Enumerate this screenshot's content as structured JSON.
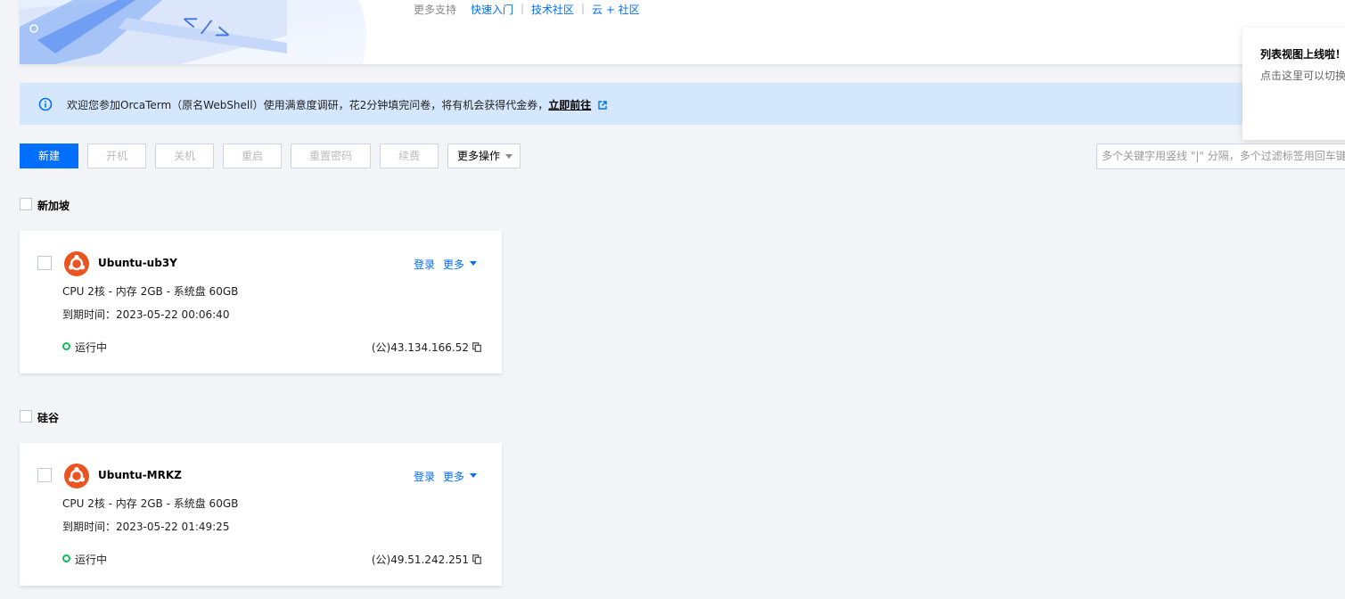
{
  "header": {
    "support_label": "更多支持",
    "links": [
      "快速入门",
      "技术社区",
      "云 + 社区"
    ],
    "separators": [
      "|",
      "|"
    ]
  },
  "tip": {
    "title": "列表视图上线啦！",
    "text": "点击这里可以切换"
  },
  "notice": {
    "text": "欢迎您参加OrcaTerm（原名WebShell）使用满意度调研，花2分钟填完问卷，将有机会获得代金券，",
    "link": "立即前往"
  },
  "toolbar": {
    "new": "新建",
    "start": "开机",
    "stop": "关机",
    "restart": "重启",
    "reset_password": "重置密码",
    "renew": "续费",
    "more": "更多操作"
  },
  "search": {
    "placeholder": "多个关键字用竖线 \"|\" 分隔，多个过滤标签用回车键分隔"
  },
  "regions": [
    {
      "name": "新加坡",
      "instance": {
        "name": "Ubuntu-ub3Y",
        "login": "登录",
        "more": "更多",
        "spec": "CPU 2核 - 内存 2GB - 系统盘 60GB",
        "expire": "到期时间：2023-05-22 00:06:40",
        "status": "运行中",
        "ip": "(公)43.134.166.52"
      }
    },
    {
      "name": "硅谷",
      "instance": {
        "name": "Ubuntu-MRKZ",
        "login": "登录",
        "more": "更多",
        "spec": "CPU 2核 - 内存 2GB - 系统盘 60GB",
        "expire": "到期时间：2023-05-22 01:49:25",
        "status": "运行中",
        "ip": "(公)49.51.242.251"
      }
    }
  ],
  "colors": {
    "primary": "#006eff",
    "notice_bg": "#d5e7fd",
    "running": "#0abf5b",
    "ubuntu": "#e95420"
  }
}
